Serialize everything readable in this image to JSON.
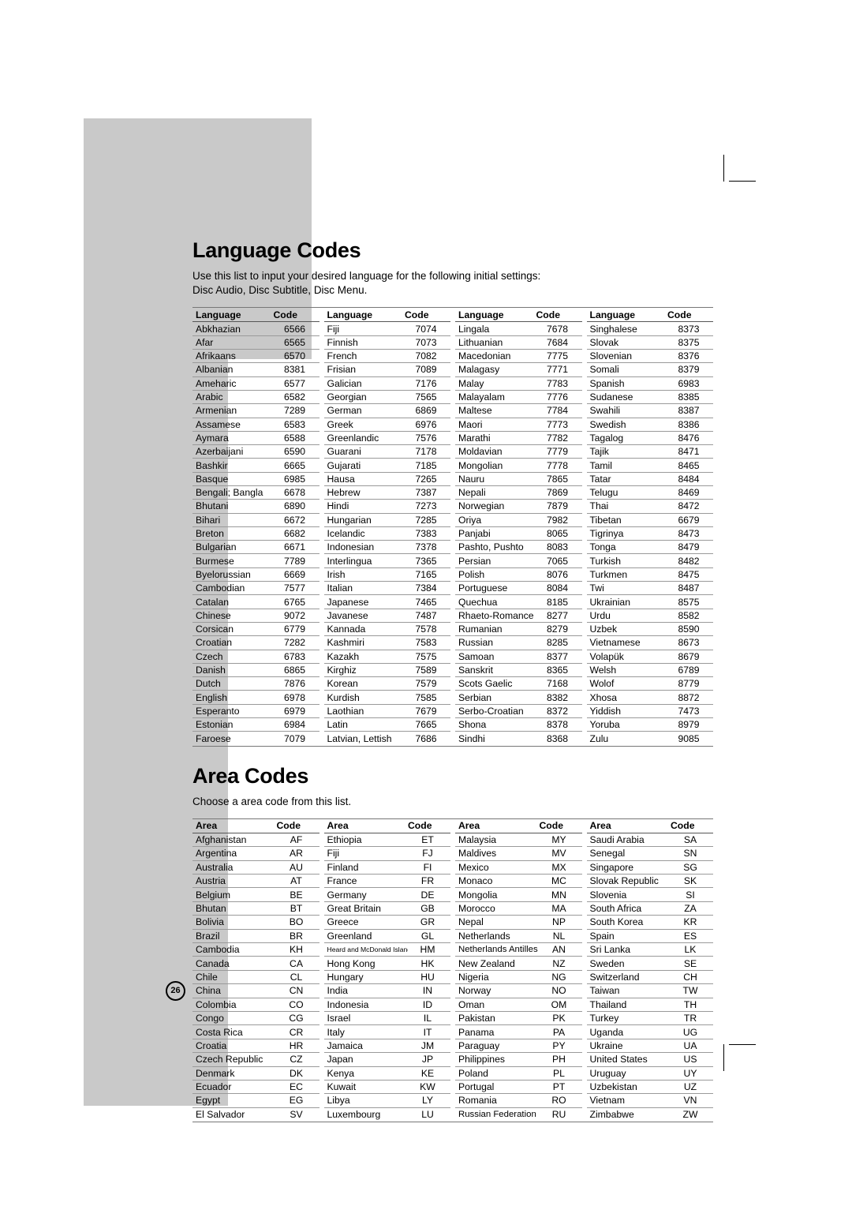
{
  "page": {
    "number": "26"
  },
  "language_section": {
    "title": "Language Codes",
    "description_line1": "Use this list to input your desired language for the following initial settings:",
    "description_line2": "Disc Audio, Disc Subtitle, Disc Menu.",
    "headers": {
      "name": "Language",
      "code": "Code"
    },
    "columns": [
      [
        [
          "Abkhazian",
          "6566"
        ],
        [
          "Afar",
          "6565"
        ],
        [
          "Afrikaans",
          "6570"
        ],
        [
          "Albanian",
          "8381"
        ],
        [
          "Ameharic",
          "6577"
        ],
        [
          "Arabic",
          "6582"
        ],
        [
          "Armenian",
          "7289"
        ],
        [
          "Assamese",
          "6583"
        ],
        [
          "Aymara",
          "6588"
        ],
        [
          "Azerbaijani",
          "6590"
        ],
        [
          "Bashkir",
          "6665"
        ],
        [
          "Basque",
          "6985"
        ],
        [
          "Bengali; Bangla",
          "6678"
        ],
        [
          "Bhutani",
          "6890"
        ],
        [
          "Bihari",
          "6672"
        ],
        [
          "Breton",
          "6682"
        ],
        [
          "Bulgarian",
          "6671"
        ],
        [
          "Burmese",
          "7789"
        ],
        [
          "Byelorussian",
          "6669"
        ],
        [
          "Cambodian",
          "7577"
        ],
        [
          "Catalan",
          "6765"
        ],
        [
          "Chinese",
          "9072"
        ],
        [
          "Corsican",
          "6779"
        ],
        [
          "Croatian",
          "7282"
        ],
        [
          "Czech",
          "6783"
        ],
        [
          "Danish",
          "6865"
        ],
        [
          "Dutch",
          "7876"
        ],
        [
          "English",
          "6978"
        ],
        [
          "Esperanto",
          "6979"
        ],
        [
          "Estonian",
          "6984"
        ],
        [
          "Faroese",
          "7079"
        ]
      ],
      [
        [
          "Fiji",
          "7074"
        ],
        [
          "Finnish",
          "7073"
        ],
        [
          "French",
          "7082"
        ],
        [
          "Frisian",
          "7089"
        ],
        [
          "Galician",
          "7176"
        ],
        [
          "Georgian",
          "7565"
        ],
        [
          "German",
          "6869"
        ],
        [
          "Greek",
          "6976"
        ],
        [
          "Greenlandic",
          "7576"
        ],
        [
          "Guarani",
          "7178"
        ],
        [
          "Gujarati",
          "7185"
        ],
        [
          "Hausa",
          "7265"
        ],
        [
          "Hebrew",
          "7387"
        ],
        [
          "Hindi",
          "7273"
        ],
        [
          "Hungarian",
          "7285"
        ],
        [
          "Icelandic",
          "7383"
        ],
        [
          "Indonesian",
          "7378"
        ],
        [
          "Interlingua",
          "7365"
        ],
        [
          "Irish",
          "7165"
        ],
        [
          "Italian",
          "7384"
        ],
        [
          "Japanese",
          "7465"
        ],
        [
          "Javanese",
          "7487"
        ],
        [
          "Kannada",
          "7578"
        ],
        [
          "Kashmiri",
          "7583"
        ],
        [
          "Kazakh",
          "7575"
        ],
        [
          "Kirghiz",
          "7589"
        ],
        [
          "Korean",
          "7579"
        ],
        [
          "Kurdish",
          "7585"
        ],
        [
          "Laothian",
          "7679"
        ],
        [
          "Latin",
          "7665"
        ],
        [
          "Latvian, Lettish",
          "7686"
        ]
      ],
      [
        [
          "Lingala",
          "7678"
        ],
        [
          "Lithuanian",
          "7684"
        ],
        [
          "Macedonian",
          "7775"
        ],
        [
          "Malagasy",
          "7771"
        ],
        [
          "Malay",
          "7783"
        ],
        [
          "Malayalam",
          "7776"
        ],
        [
          "Maltese",
          "7784"
        ],
        [
          "Maori",
          "7773"
        ],
        [
          "Marathi",
          "7782"
        ],
        [
          "Moldavian",
          "7779"
        ],
        [
          "Mongolian",
          "7778"
        ],
        [
          "Nauru",
          "7865"
        ],
        [
          "Nepali",
          "7869"
        ],
        [
          "Norwegian",
          "7879"
        ],
        [
          "Oriya",
          "7982"
        ],
        [
          "Panjabi",
          "8065"
        ],
        [
          "Pashto, Pushto",
          "8083"
        ],
        [
          "Persian",
          "7065"
        ],
        [
          "Polish",
          "8076"
        ],
        [
          "Portuguese",
          "8084"
        ],
        [
          "Quechua",
          "8185"
        ],
        [
          "Rhaeto-Romance",
          "8277"
        ],
        [
          "Rumanian",
          "8279"
        ],
        [
          "Russian",
          "8285"
        ],
        [
          "Samoan",
          "8377"
        ],
        [
          "Sanskrit",
          "8365"
        ],
        [
          "Scots Gaelic",
          "7168"
        ],
        [
          "Serbian",
          "8382"
        ],
        [
          "Serbo-Croatian",
          "8372"
        ],
        [
          "Shona",
          "8378"
        ],
        [
          "Sindhi",
          "8368"
        ]
      ],
      [
        [
          "Singhalese",
          "8373"
        ],
        [
          "Slovak",
          "8375"
        ],
        [
          "Slovenian",
          "8376"
        ],
        [
          "Somali",
          "8379"
        ],
        [
          "Spanish",
          "6983"
        ],
        [
          "Sudanese",
          "8385"
        ],
        [
          "Swahili",
          "8387"
        ],
        [
          "Swedish",
          "8386"
        ],
        [
          "Tagalog",
          "8476"
        ],
        [
          "Tajik",
          "8471"
        ],
        [
          "Tamil",
          "8465"
        ],
        [
          "Tatar",
          "8484"
        ],
        [
          "Telugu",
          "8469"
        ],
        [
          "Thai",
          "8472"
        ],
        [
          "Tibetan",
          "6679"
        ],
        [
          "Tigrinya",
          "8473"
        ],
        [
          "Tonga",
          "8479"
        ],
        [
          "Turkish",
          "8482"
        ],
        [
          "Turkmen",
          "8475"
        ],
        [
          "Twi",
          "8487"
        ],
        [
          "Ukrainian",
          "8575"
        ],
        [
          "Urdu",
          "8582"
        ],
        [
          "Uzbek",
          "8590"
        ],
        [
          "Vietnamese",
          "8673"
        ],
        [
          "Volapük",
          "8679"
        ],
        [
          "Welsh",
          "6789"
        ],
        [
          "Wolof",
          "8779"
        ],
        [
          "Xhosa",
          "8872"
        ],
        [
          "Yiddish",
          "7473"
        ],
        [
          "Yoruba",
          "8979"
        ],
        [
          "Zulu",
          "9085"
        ]
      ]
    ]
  },
  "area_section": {
    "title": "Area Codes",
    "description_line1": "Choose a area code from this list.",
    "headers": {
      "name": "Area",
      "code": "Code"
    },
    "columns": [
      [
        [
          "Afghanistan",
          "AF"
        ],
        [
          "Argentina",
          "AR"
        ],
        [
          "Australia",
          "AU"
        ],
        [
          "Austria",
          "AT"
        ],
        [
          "Belgium",
          "BE"
        ],
        [
          "Bhutan",
          "BT"
        ],
        [
          "Bolivia",
          "BO"
        ],
        [
          "Brazil",
          "BR"
        ],
        [
          "Cambodia",
          "KH"
        ],
        [
          "Canada",
          "CA"
        ],
        [
          "Chile",
          "CL"
        ],
        [
          "China",
          "CN"
        ],
        [
          "Colombia",
          "CO"
        ],
        [
          "Congo",
          "CG"
        ],
        [
          "Costa Rica",
          "CR"
        ],
        [
          "Croatia",
          "HR"
        ],
        [
          "Czech Republic",
          "CZ"
        ],
        [
          "Denmark",
          "DK"
        ],
        [
          "Ecuador",
          "EC"
        ],
        [
          "Egypt",
          "EG"
        ],
        [
          "El Salvador",
          "SV"
        ]
      ],
      [
        [
          "Ethiopia",
          "ET"
        ],
        [
          "Fiji",
          "FJ"
        ],
        [
          "Finland",
          "FI"
        ],
        [
          "France",
          "FR"
        ],
        [
          "Germany",
          "DE"
        ],
        [
          "Great Britain",
          "GB"
        ],
        [
          "Greece",
          "GR"
        ],
        [
          "Greenland",
          "GL"
        ],
        [
          "Heard and McDonald Islands",
          "HM"
        ],
        [
          "Hong Kong",
          "HK"
        ],
        [
          "Hungary",
          "HU"
        ],
        [
          "India",
          "IN"
        ],
        [
          "Indonesia",
          "ID"
        ],
        [
          "Israel",
          "IL"
        ],
        [
          "Italy",
          "IT"
        ],
        [
          "Jamaica",
          "JM"
        ],
        [
          "Japan",
          "JP"
        ],
        [
          "Kenya",
          "KE"
        ],
        [
          "Kuwait",
          "KW"
        ],
        [
          "Libya",
          "LY"
        ],
        [
          "Luxembourg",
          "LU"
        ]
      ],
      [
        [
          "Malaysia",
          "MY"
        ],
        [
          "Maldives",
          "MV"
        ],
        [
          "Mexico",
          "MX"
        ],
        [
          "Monaco",
          "MC"
        ],
        [
          "Mongolia",
          "MN"
        ],
        [
          "Morocco",
          "MA"
        ],
        [
          "Nepal",
          "NP"
        ],
        [
          "Netherlands",
          "NL"
        ],
        [
          "Netherlands Antilles",
          "AN"
        ],
        [
          "New Zealand",
          "NZ"
        ],
        [
          "Nigeria",
          "NG"
        ],
        [
          "Norway",
          "NO"
        ],
        [
          "Oman",
          "OM"
        ],
        [
          "Pakistan",
          "PK"
        ],
        [
          "Panama",
          "PA"
        ],
        [
          "Paraguay",
          "PY"
        ],
        [
          "Philippines",
          "PH"
        ],
        [
          "Poland",
          "PL"
        ],
        [
          "Portugal",
          "PT"
        ],
        [
          "Romania",
          "RO"
        ],
        [
          "Russian Federation",
          "RU"
        ]
      ],
      [
        [
          "Saudi Arabia",
          "SA"
        ],
        [
          "Senegal",
          "SN"
        ],
        [
          "Singapore",
          "SG"
        ],
        [
          "Slovak Republic",
          "SK"
        ],
        [
          "Slovenia",
          "SI"
        ],
        [
          "South Africa",
          "ZA"
        ],
        [
          "South Korea",
          "KR"
        ],
        [
          "Spain",
          "ES"
        ],
        [
          "Sri Lanka",
          "LK"
        ],
        [
          "Sweden",
          "SE"
        ],
        [
          "Switzerland",
          "CH"
        ],
        [
          "Taiwan",
          "TW"
        ],
        [
          "Thailand",
          "TH"
        ],
        [
          "Turkey",
          "TR"
        ],
        [
          "Uganda",
          "UG"
        ],
        [
          "Ukraine",
          "UA"
        ],
        [
          "United States",
          "US"
        ],
        [
          "Uruguay",
          "UY"
        ],
        [
          "Uzbekistan",
          "UZ"
        ],
        [
          "Vietnam",
          "VN"
        ],
        [
          "Zimbabwe",
          "ZW"
        ]
      ]
    ]
  }
}
